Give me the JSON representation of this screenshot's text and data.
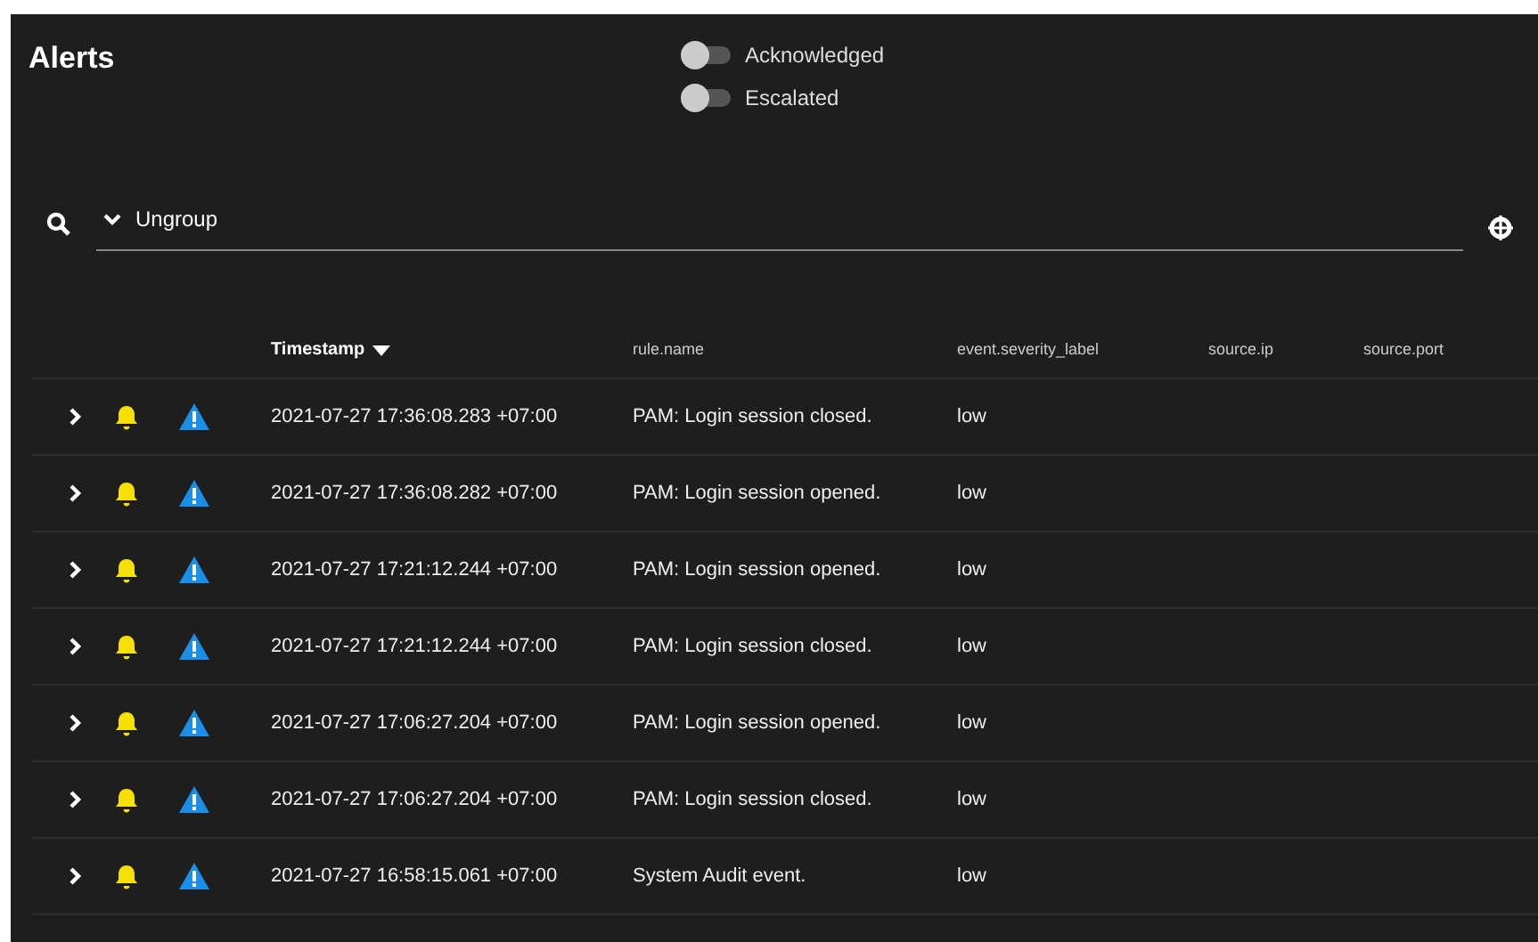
{
  "title": "Alerts",
  "toggles": [
    {
      "label": "Acknowledged",
      "on": false
    },
    {
      "label": "Escalated",
      "on": false
    }
  ],
  "group_select": {
    "value": "Ungroup"
  },
  "table": {
    "columns": [
      {
        "label": "Timestamp",
        "sorted": true
      },
      {
        "label": "rule.name",
        "sorted": false
      },
      {
        "label": "event.severity_label",
        "sorted": false
      },
      {
        "label": "source.ip",
        "sorted": false
      },
      {
        "label": "source.port",
        "sorted": false
      }
    ],
    "rows": [
      {
        "timestamp": "2021-07-27 17:36:08.283 +07:00",
        "rule_name": "PAM: Login session closed.",
        "severity": "low"
      },
      {
        "timestamp": "2021-07-27 17:36:08.282 +07:00",
        "rule_name": "PAM: Login session opened.",
        "severity": "low"
      },
      {
        "timestamp": "2021-07-27 17:21:12.244 +07:00",
        "rule_name": "PAM: Login session opened.",
        "severity": "low"
      },
      {
        "timestamp": "2021-07-27 17:21:12.244 +07:00",
        "rule_name": "PAM: Login session closed.",
        "severity": "low"
      },
      {
        "timestamp": "2021-07-27 17:06:27.204 +07:00",
        "rule_name": "PAM: Login session opened.",
        "severity": "low"
      },
      {
        "timestamp": "2021-07-27 17:06:27.204 +07:00",
        "rule_name": "PAM: Login session closed.",
        "severity": "low"
      },
      {
        "timestamp": "2021-07-27 16:58:15.061 +07:00",
        "rule_name": "System Audit event.",
        "severity": "low"
      }
    ]
  }
}
